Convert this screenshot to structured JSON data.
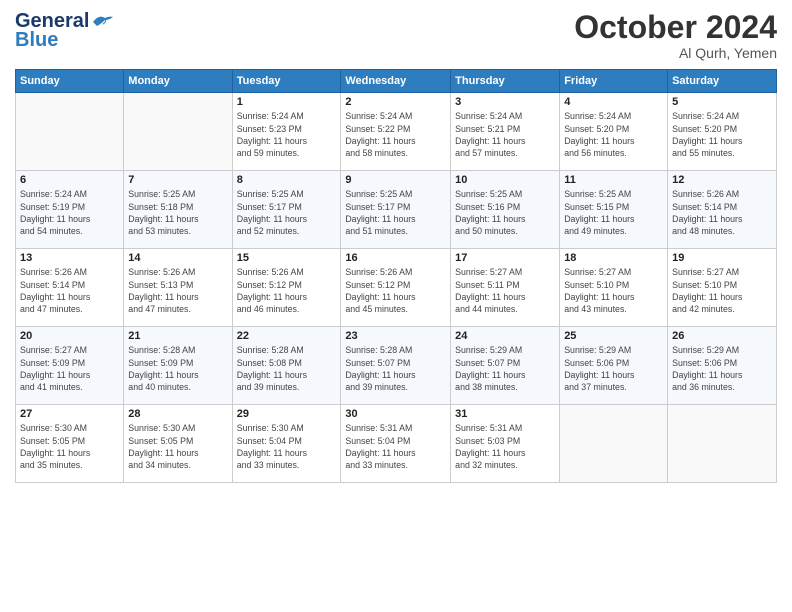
{
  "header": {
    "logo_line1": "General",
    "logo_line2": "Blue",
    "month": "October 2024",
    "location": "Al Qurh, Yemen"
  },
  "days_of_week": [
    "Sunday",
    "Monday",
    "Tuesday",
    "Wednesday",
    "Thursday",
    "Friday",
    "Saturday"
  ],
  "weeks": [
    [
      {
        "day": "",
        "info": ""
      },
      {
        "day": "",
        "info": ""
      },
      {
        "day": "1",
        "info": "Sunrise: 5:24 AM\nSunset: 5:23 PM\nDaylight: 11 hours\nand 59 minutes."
      },
      {
        "day": "2",
        "info": "Sunrise: 5:24 AM\nSunset: 5:22 PM\nDaylight: 11 hours\nand 58 minutes."
      },
      {
        "day": "3",
        "info": "Sunrise: 5:24 AM\nSunset: 5:21 PM\nDaylight: 11 hours\nand 57 minutes."
      },
      {
        "day": "4",
        "info": "Sunrise: 5:24 AM\nSunset: 5:20 PM\nDaylight: 11 hours\nand 56 minutes."
      },
      {
        "day": "5",
        "info": "Sunrise: 5:24 AM\nSunset: 5:20 PM\nDaylight: 11 hours\nand 55 minutes."
      }
    ],
    [
      {
        "day": "6",
        "info": "Sunrise: 5:24 AM\nSunset: 5:19 PM\nDaylight: 11 hours\nand 54 minutes."
      },
      {
        "day": "7",
        "info": "Sunrise: 5:25 AM\nSunset: 5:18 PM\nDaylight: 11 hours\nand 53 minutes."
      },
      {
        "day": "8",
        "info": "Sunrise: 5:25 AM\nSunset: 5:17 PM\nDaylight: 11 hours\nand 52 minutes."
      },
      {
        "day": "9",
        "info": "Sunrise: 5:25 AM\nSunset: 5:17 PM\nDaylight: 11 hours\nand 51 minutes."
      },
      {
        "day": "10",
        "info": "Sunrise: 5:25 AM\nSunset: 5:16 PM\nDaylight: 11 hours\nand 50 minutes."
      },
      {
        "day": "11",
        "info": "Sunrise: 5:25 AM\nSunset: 5:15 PM\nDaylight: 11 hours\nand 49 minutes."
      },
      {
        "day": "12",
        "info": "Sunrise: 5:26 AM\nSunset: 5:14 PM\nDaylight: 11 hours\nand 48 minutes."
      }
    ],
    [
      {
        "day": "13",
        "info": "Sunrise: 5:26 AM\nSunset: 5:14 PM\nDaylight: 11 hours\nand 47 minutes."
      },
      {
        "day": "14",
        "info": "Sunrise: 5:26 AM\nSunset: 5:13 PM\nDaylight: 11 hours\nand 47 minutes."
      },
      {
        "day": "15",
        "info": "Sunrise: 5:26 AM\nSunset: 5:12 PM\nDaylight: 11 hours\nand 46 minutes."
      },
      {
        "day": "16",
        "info": "Sunrise: 5:26 AM\nSunset: 5:12 PM\nDaylight: 11 hours\nand 45 minutes."
      },
      {
        "day": "17",
        "info": "Sunrise: 5:27 AM\nSunset: 5:11 PM\nDaylight: 11 hours\nand 44 minutes."
      },
      {
        "day": "18",
        "info": "Sunrise: 5:27 AM\nSunset: 5:10 PM\nDaylight: 11 hours\nand 43 minutes."
      },
      {
        "day": "19",
        "info": "Sunrise: 5:27 AM\nSunset: 5:10 PM\nDaylight: 11 hours\nand 42 minutes."
      }
    ],
    [
      {
        "day": "20",
        "info": "Sunrise: 5:27 AM\nSunset: 5:09 PM\nDaylight: 11 hours\nand 41 minutes."
      },
      {
        "day": "21",
        "info": "Sunrise: 5:28 AM\nSunset: 5:09 PM\nDaylight: 11 hours\nand 40 minutes."
      },
      {
        "day": "22",
        "info": "Sunrise: 5:28 AM\nSunset: 5:08 PM\nDaylight: 11 hours\nand 39 minutes."
      },
      {
        "day": "23",
        "info": "Sunrise: 5:28 AM\nSunset: 5:07 PM\nDaylight: 11 hours\nand 39 minutes."
      },
      {
        "day": "24",
        "info": "Sunrise: 5:29 AM\nSunset: 5:07 PM\nDaylight: 11 hours\nand 38 minutes."
      },
      {
        "day": "25",
        "info": "Sunrise: 5:29 AM\nSunset: 5:06 PM\nDaylight: 11 hours\nand 37 minutes."
      },
      {
        "day": "26",
        "info": "Sunrise: 5:29 AM\nSunset: 5:06 PM\nDaylight: 11 hours\nand 36 minutes."
      }
    ],
    [
      {
        "day": "27",
        "info": "Sunrise: 5:30 AM\nSunset: 5:05 PM\nDaylight: 11 hours\nand 35 minutes."
      },
      {
        "day": "28",
        "info": "Sunrise: 5:30 AM\nSunset: 5:05 PM\nDaylight: 11 hours\nand 34 minutes."
      },
      {
        "day": "29",
        "info": "Sunrise: 5:30 AM\nSunset: 5:04 PM\nDaylight: 11 hours\nand 33 minutes."
      },
      {
        "day": "30",
        "info": "Sunrise: 5:31 AM\nSunset: 5:04 PM\nDaylight: 11 hours\nand 33 minutes."
      },
      {
        "day": "31",
        "info": "Sunrise: 5:31 AM\nSunset: 5:03 PM\nDaylight: 11 hours\nand 32 minutes."
      },
      {
        "day": "",
        "info": ""
      },
      {
        "day": "",
        "info": ""
      }
    ]
  ]
}
